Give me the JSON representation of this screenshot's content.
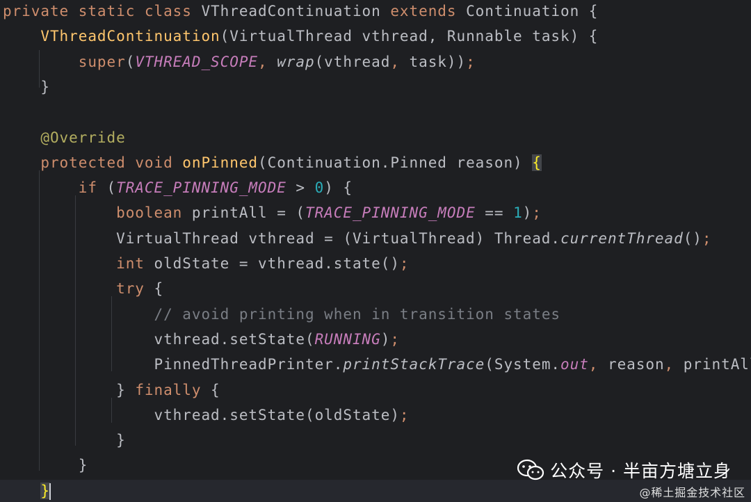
{
  "editor": {
    "lines": [
      {
        "id": "line-1",
        "tokens": [
          {
            "t": "private",
            "c": "kw"
          },
          {
            "t": " "
          },
          {
            "t": "static",
            "c": "kw"
          },
          {
            "t": " "
          },
          {
            "t": "class",
            "c": "kw"
          },
          {
            "t": " VThreadContinuation "
          },
          {
            "t": "extends",
            "c": "kw"
          },
          {
            "t": " Continuation {"
          }
        ]
      },
      {
        "id": "line-2",
        "tokens": [
          {
            "t": "    "
          },
          {
            "t": "VThreadContinuation",
            "c": "fnd"
          },
          {
            "t": "(VirtualThread vthread, Runnable task) {"
          }
        ]
      },
      {
        "id": "line-3",
        "tokens": [
          {
            "t": "        "
          },
          {
            "t": "super",
            "c": "kw"
          },
          {
            "t": "("
          },
          {
            "t": "VTHREAD_SCOPE",
            "c": "const"
          },
          {
            "t": ", ",
            "c": "kw"
          },
          {
            "t": "wrap",
            "c": "it"
          },
          {
            "t": "(vthread"
          },
          {
            "t": ", ",
            "c": "kw"
          },
          {
            "t": "task))"
          },
          {
            "t": ";",
            "c": "kw"
          }
        ]
      },
      {
        "id": "line-4",
        "tokens": [
          {
            "t": "    }"
          }
        ]
      },
      {
        "id": "line-5",
        "tokens": [
          {
            "t": ""
          }
        ]
      },
      {
        "id": "line-6",
        "tokens": [
          {
            "t": "    "
          },
          {
            "t": "@Override",
            "c": "ann"
          }
        ]
      },
      {
        "id": "line-7",
        "tokens": [
          {
            "t": "    "
          },
          {
            "t": "protected",
            "c": "kw"
          },
          {
            "t": " "
          },
          {
            "t": "void",
            "c": "kw"
          },
          {
            "t": " "
          },
          {
            "t": "onPinned",
            "c": "fnd"
          },
          {
            "t": "(Continuation.Pinned reason) "
          },
          {
            "t": "{",
            "c": "brace-hl"
          }
        ]
      },
      {
        "id": "line-8",
        "tokens": [
          {
            "t": "        "
          },
          {
            "t": "if",
            "c": "kw"
          },
          {
            "t": " ("
          },
          {
            "t": "TRACE_PINNING_MODE",
            "c": "const"
          },
          {
            "t": " > "
          },
          {
            "t": "0",
            "c": "num"
          },
          {
            "t": ") {"
          }
        ]
      },
      {
        "id": "line-9",
        "tokens": [
          {
            "t": "            "
          },
          {
            "t": "boolean",
            "c": "kw"
          },
          {
            "t": " printAll = ("
          },
          {
            "t": "TRACE_PINNING_MODE",
            "c": "const"
          },
          {
            "t": " == "
          },
          {
            "t": "1",
            "c": "num"
          },
          {
            "t": ")"
          },
          {
            "t": ";",
            "c": "kw"
          }
        ]
      },
      {
        "id": "line-10",
        "tokens": [
          {
            "t": "            VirtualThread vthread = (VirtualThread) Thread."
          },
          {
            "t": "currentThread",
            "c": "it"
          },
          {
            "t": "()"
          },
          {
            "t": ";",
            "c": "kw"
          }
        ]
      },
      {
        "id": "line-11",
        "tokens": [
          {
            "t": "            "
          },
          {
            "t": "int",
            "c": "kw"
          },
          {
            "t": " oldState = vthread.state()"
          },
          {
            "t": ";",
            "c": "kw"
          }
        ]
      },
      {
        "id": "line-12",
        "tokens": [
          {
            "t": "            "
          },
          {
            "t": "try",
            "c": "kw"
          },
          {
            "t": " {"
          }
        ]
      },
      {
        "id": "line-13",
        "tokens": [
          {
            "t": "                "
          },
          {
            "t": "// avoid printing when in transition states",
            "c": "cmt"
          }
        ]
      },
      {
        "id": "line-14",
        "tokens": [
          {
            "t": "                vthread.setState("
          },
          {
            "t": "RUNNING",
            "c": "const"
          },
          {
            "t": ")"
          },
          {
            "t": ";",
            "c": "kw"
          }
        ]
      },
      {
        "id": "line-15",
        "tokens": [
          {
            "t": "                PinnedThreadPrinter."
          },
          {
            "t": "printStackTrace",
            "c": "it"
          },
          {
            "t": "(System."
          },
          {
            "t": "out",
            "c": "field"
          },
          {
            "t": ", ",
            "c": "kw"
          },
          {
            "t": "reason"
          },
          {
            "t": ", ",
            "c": "kw"
          },
          {
            "t": "printAll)"
          },
          {
            "t": ";",
            "c": "kw"
          }
        ]
      },
      {
        "id": "line-16",
        "tokens": [
          {
            "t": "            } "
          },
          {
            "t": "finally",
            "c": "kw"
          },
          {
            "t": " {"
          }
        ]
      },
      {
        "id": "line-17",
        "tokens": [
          {
            "t": "                vthread.setState(oldState)"
          },
          {
            "t": ";",
            "c": "kw"
          }
        ]
      },
      {
        "id": "line-18",
        "tokens": [
          {
            "t": "            }"
          }
        ]
      },
      {
        "id": "line-19",
        "tokens": [
          {
            "t": "        }"
          }
        ]
      },
      {
        "id": "line-20",
        "tokens": [
          {
            "t": "    "
          },
          {
            "t": "}",
            "c": "brace-hl",
            "caret": true
          }
        ]
      }
    ]
  },
  "watermark": {
    "icon": "wechat-icon",
    "text": "公众号 · 半亩方塘立身"
  },
  "site_credit": "@稀土掘金技术社区"
}
